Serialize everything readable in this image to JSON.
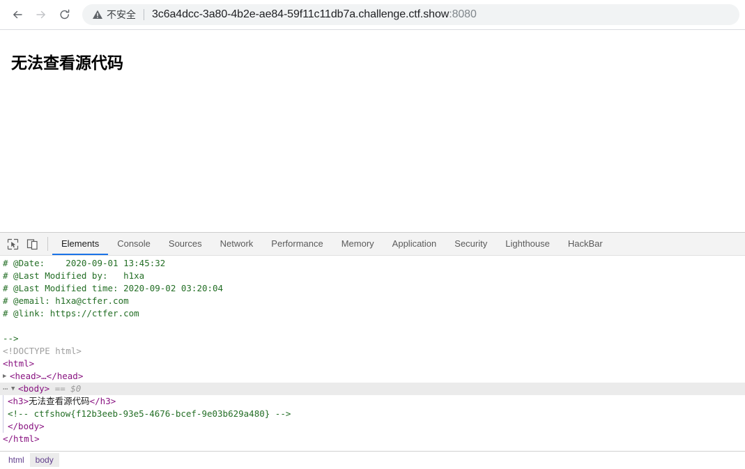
{
  "browser": {
    "back_icon": "arrow-left-icon",
    "forward_icon": "arrow-right-icon",
    "reload_icon": "reload-icon",
    "security_icon": "warning-triangle-icon",
    "security_label": "不安全",
    "url_host": "3c6a4dcc-3a80-4b2e-ae84-59f11c11db7a.challenge.ctf.show",
    "url_port": ":8080"
  },
  "page": {
    "heading": "无法查看源代码"
  },
  "devtools": {
    "inspect_icon": "inspect-element-icon",
    "device_icon": "device-toolbar-icon",
    "tabs": [
      {
        "label": "Elements",
        "active": true
      },
      {
        "label": "Console",
        "active": false
      },
      {
        "label": "Sources",
        "active": false
      },
      {
        "label": "Network",
        "active": false
      },
      {
        "label": "Performance",
        "active": false
      },
      {
        "label": "Memory",
        "active": false
      },
      {
        "label": "Application",
        "active": false
      },
      {
        "label": "Security",
        "active": false
      },
      {
        "label": "Lighthouse",
        "active": false
      },
      {
        "label": "HackBar",
        "active": false
      }
    ],
    "dom_lines": {
      "comment_date": "# @Date:    2020-09-01 13:45:32",
      "comment_modified_by": "# @Last Modified by:   h1xa",
      "comment_modified_time": "# @Last Modified time: 2020-09-02 03:20:04",
      "comment_email": "# @email: h1xa@ctfer.com",
      "comment_link": "# @link: https://ctfer.com",
      "comment_close": "-->",
      "doctype": "<!DOCTYPE html>",
      "html_open": "<html>",
      "head_collapsed": "<head>…</head>",
      "body_open": "<body>",
      "body_marker": "== $0",
      "h3_open": "<h3>",
      "h3_text": "无法查看源代码",
      "h3_close": "</h3>",
      "flag_comment": "<!-- ctfshow{f12b3eeb-93e5-4676-bcef-9e03b629a480} -->",
      "body_close": "</body>",
      "html_close": "</html>"
    },
    "breadcrumbs": [
      {
        "label": "html",
        "active": false
      },
      {
        "label": "body",
        "active": true
      }
    ]
  },
  "colors": {
    "accent_blue": "#1a73e8",
    "comment_green": "#236e25",
    "tag_purple": "#881280",
    "omnibox_bg": "#f1f3f4",
    "selected_row": "#ebebeb"
  }
}
